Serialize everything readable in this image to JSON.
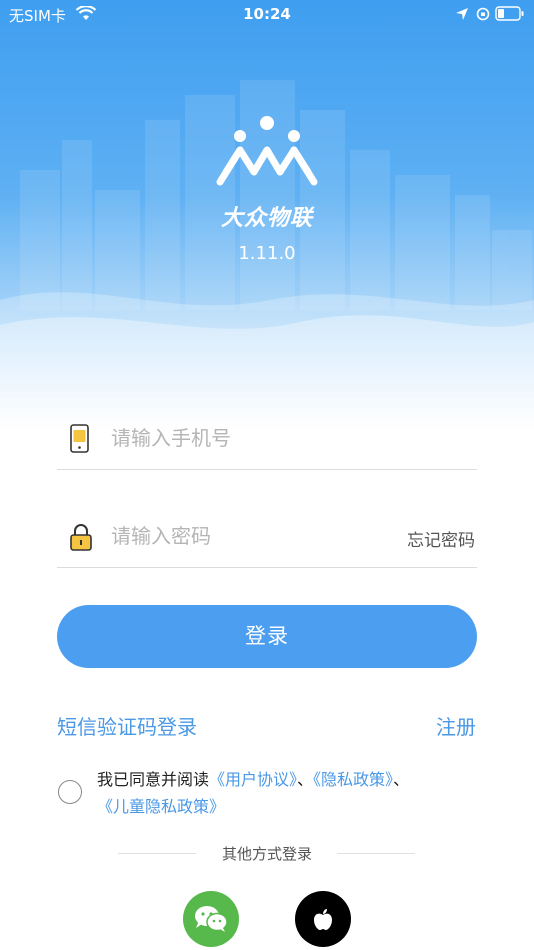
{
  "status_bar": {
    "carrier": "无SIM卡",
    "time": "10:24"
  },
  "brand": {
    "name": "大众物联",
    "version": "1.11.0"
  },
  "login_form": {
    "phone_placeholder": "请输入手机号",
    "password_placeholder": "请输入密码",
    "forgot_password": "忘记密码",
    "login_button": "登录"
  },
  "links": {
    "sms_login": "短信验证码登录",
    "register": "注册"
  },
  "agreement": {
    "prefix": "我已同意并阅读",
    "user_agreement": "《用户协议》",
    "sep1": "、",
    "privacy_policy": "《隐私政策》",
    "sep2": "、",
    "child_privacy_policy": "《儿童隐私政策》"
  },
  "other_login": {
    "label": "其他方式登录",
    "methods": [
      "wechat-icon",
      "apple-icon"
    ]
  },
  "colors": {
    "primary": "#4c9ff0",
    "link": "#4a98e6",
    "wechat": "#57b84b"
  }
}
